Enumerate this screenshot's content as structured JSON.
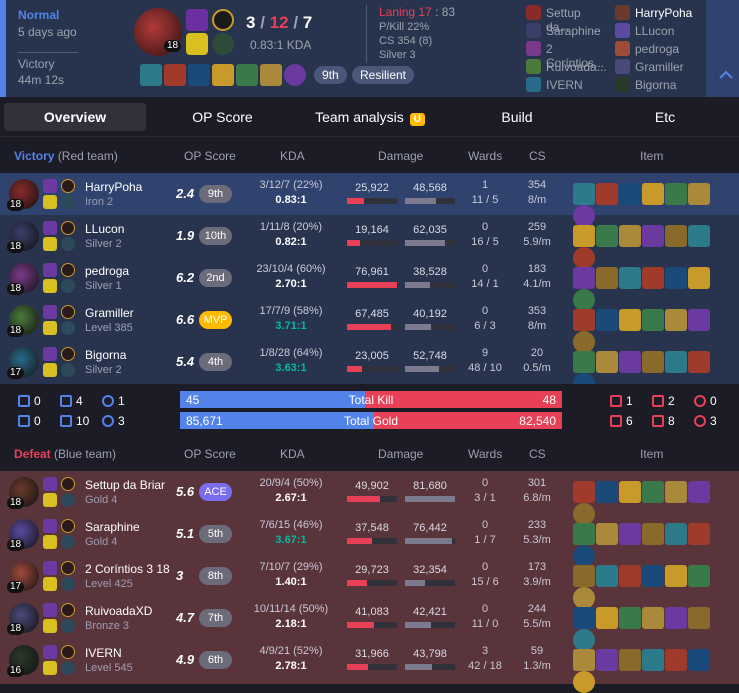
{
  "header": {
    "mode": "Normal",
    "ago": "5 days ago",
    "result": "Victory",
    "duration": "44m 12s",
    "champ_level": "18",
    "kda": {
      "k": "3",
      "sep1": "/",
      "d": "12",
      "sep2": "/",
      "a": "7"
    },
    "kda_ratio": "0.83:1 KDA",
    "laning_label": "Laning 17",
    "laning_sep": ":",
    "laning_value": "83",
    "pkill": "P/Kill 22%",
    "cs": "CS 354 (8)",
    "tier": "Silver 3",
    "badges": [
      "9th",
      "Resilient"
    ],
    "participants_left": [
      "Settup da...",
      "Saraphine",
      "2 Coríntios...",
      "Ruivoada...",
      "IVERN"
    ],
    "participants_right": [
      "HarryPoha",
      "LLucon",
      "pedroga",
      "Gramiller",
      "Bigorna"
    ],
    "expand_icon": "chevron-up-icon"
  },
  "tabs": [
    "Overview",
    "OP Score",
    "Team analysis",
    "Build",
    "Etc"
  ],
  "tab_badge": "U",
  "victory": {
    "result": "Victory",
    "team": "(Red team)",
    "cols": [
      "OP Score",
      "KDA",
      "Damage",
      "Wards",
      "CS",
      "Item"
    ],
    "rows": [
      {
        "name": "HarryPoha",
        "tier": "Iron 2",
        "lvl": "18",
        "score": "2.4",
        "rank": "9th",
        "kda": "3/12/7 (22%)",
        "ratio": "0.83:1",
        "dmg": "25,922",
        "taken": "48,568",
        "dp": 0.33,
        "tp": 0.62,
        "wards": "1",
        "wards2": "11 / 5",
        "cs": "354",
        "csm": "8/m",
        "hl": true
      },
      {
        "name": "LLucon",
        "tier": "Silver 2",
        "lvl": "18",
        "score": "1.9",
        "rank": "10th",
        "kda": "1/11/8 (20%)",
        "ratio": "0.82:1",
        "dmg": "19,164",
        "taken": "62,035",
        "dp": 0.25,
        "tp": 0.79,
        "wards": "0",
        "wards2": "16 / 5",
        "cs": "259",
        "csm": "5.9/m"
      },
      {
        "name": "pedroga",
        "tier": "Silver 1",
        "lvl": "18",
        "score": "6.2",
        "rank": "2nd",
        "kda": "23/10/4 (60%)",
        "ratio": "2.70:1",
        "dmg": "76,961",
        "taken": "38,528",
        "dp": 1.0,
        "tp": 0.49,
        "wards": "0",
        "wards2": "14 / 1",
        "cs": "183",
        "csm": "4.1/m"
      },
      {
        "name": "Gramiller",
        "tier": "Level 385",
        "lvl": "18",
        "score": "6.6",
        "rank": "MVP",
        "kda": "17/7/9 (58%)",
        "ratio": "3.71:1",
        "dmg": "67,485",
        "taken": "40,192",
        "dp": 0.88,
        "tp": 0.51,
        "wards": "0",
        "wards2": "6 / 3",
        "cs": "353",
        "csm": "8/m",
        "g": true
      },
      {
        "name": "Bigorna",
        "tier": "Silver 2",
        "lvl": "17",
        "score": "5.4",
        "rank": "4th",
        "kda": "1/8/28 (64%)",
        "ratio": "3.63:1",
        "dmg": "23,005",
        "taken": "52,748",
        "dp": 0.3,
        "tp": 0.67,
        "wards": "9",
        "wards2": "48 / 10",
        "cs": "20",
        "csm": "0.5/m",
        "g": true
      }
    ]
  },
  "summary": {
    "left_obj": [
      [
        "0",
        "4",
        "1"
      ],
      [
        "0",
        "10",
        "3"
      ]
    ],
    "right_obj": [
      [
        "1",
        "2",
        "0"
      ],
      [
        "6",
        "8",
        "3"
      ]
    ],
    "kill": {
      "left": "45",
      "label": "Total Kill",
      "right": "48",
      "lp": 0.484
    },
    "gold": {
      "left": "85,671",
      "label": "Total Gold",
      "right": "82,540",
      "lp": 0.509
    }
  },
  "defeat": {
    "result": "Defeat",
    "team": "(Blue team)",
    "cols": [
      "OP Score",
      "KDA",
      "Damage",
      "Wards",
      "CS",
      "Item"
    ],
    "rows": [
      {
        "name": "Settup da Briar",
        "tier": "Gold 4",
        "lvl": "18",
        "score": "5.6",
        "rank": "ACE",
        "kda": "20/9/4 (50%)",
        "ratio": "2.67:1",
        "dmg": "49,902",
        "taken": "81,680",
        "dp": 0.65,
        "tp": 1.0,
        "wards": "0",
        "wards2": "3 / 1",
        "cs": "301",
        "csm": "6.8/m"
      },
      {
        "name": "Saraphine",
        "tier": "Gold 4",
        "lvl": "18",
        "score": "5.1",
        "rank": "5th",
        "kda": "7/6/15 (46%)",
        "ratio": "3.67:1",
        "dmg": "37,548",
        "taken": "76,442",
        "dp": 0.49,
        "tp": 0.94,
        "wards": "0",
        "wards2": "1 / 7",
        "cs": "233",
        "csm": "5.3/m",
        "g": true
      },
      {
        "name": "2 Coríntios 3 18",
        "tier": "Level 425",
        "lvl": "17",
        "score": "3",
        "rank": "8th",
        "kda": "7/10/7 (29%)",
        "ratio": "1.40:1",
        "dmg": "29,723",
        "taken": "32,354",
        "dp": 0.39,
        "tp": 0.4,
        "wards": "0",
        "wards2": "15 / 6",
        "cs": "173",
        "csm": "3.9/m"
      },
      {
        "name": "RuivoadaXD",
        "tier": "Bronze 3",
        "lvl": "18",
        "score": "4.7",
        "rank": "7th",
        "kda": "10/11/14 (50%)",
        "ratio": "2.18:1",
        "dmg": "41,083",
        "taken": "42,421",
        "dp": 0.53,
        "tp": 0.52,
        "wards": "0",
        "wards2": "11 / 0",
        "cs": "244",
        "csm": "5.5/m"
      },
      {
        "name": "IVERN",
        "tier": "Level 545",
        "lvl": "16",
        "score": "4.9",
        "rank": "6th",
        "kda": "4/9/21 (52%)",
        "ratio": "2.78:1",
        "dmg": "31,966",
        "taken": "43,798",
        "dp": 0.42,
        "tp": 0.54,
        "wards": "3",
        "wards2": "42 / 18",
        "cs": "59",
        "csm": "1.3/m"
      }
    ]
  },
  "colors": {
    "victory": "#5383e8",
    "defeat": "#e84057",
    "win_bg": "#28344e",
    "lose_bg": "#59343b",
    "hl_bg": "#2f436e",
    "mvp": "#ffb900",
    "ace": "#7a6cf0"
  }
}
